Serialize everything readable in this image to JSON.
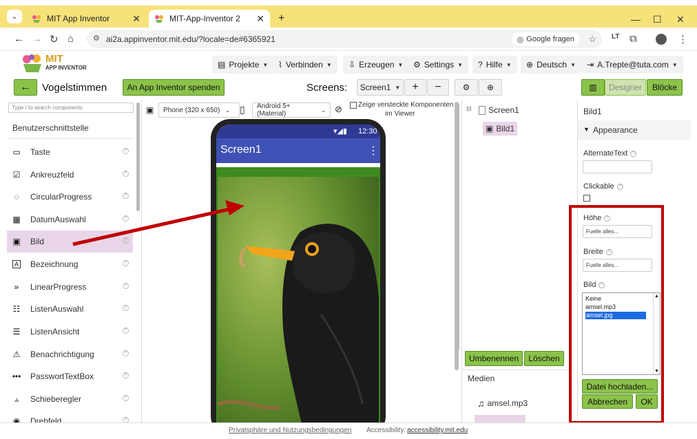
{
  "browser": {
    "tabs": [
      {
        "label": "MIT App Inventor"
      },
      {
        "label": "MIT-App-Inventor 2"
      }
    ],
    "url": "ai2a.appinventor.mit.edu/?locale=de#6365921",
    "google_ask": "Google fragen"
  },
  "header": {
    "logo_top": "MIT",
    "logo_bottom": "APP INVENTOR",
    "menu": [
      {
        "label": "Projekte"
      },
      {
        "label": "Verbinden"
      },
      {
        "label": "Erzeugen"
      },
      {
        "label": "Settings"
      },
      {
        "label": "Hilfe"
      },
      {
        "label": "Deutsch"
      },
      {
        "label": "A.Trepte@tuta.com"
      }
    ]
  },
  "toolbar": {
    "project_name": "Vogelstimmen",
    "donate": "An App Inventor spenden",
    "screens_label": "Screens:",
    "screen_select": "Screen1",
    "designer": "Designer",
    "blocks": "Blöcke"
  },
  "palette": {
    "search_placeholder": "Type / to search components",
    "category": "Benutzerschnittstelle",
    "items": [
      {
        "label": "Taste",
        "icon": "button-icon"
      },
      {
        "label": "Ankreuzfeld",
        "icon": "checkbox-icon"
      },
      {
        "label": "CircularProgress",
        "icon": "circular-progress-icon"
      },
      {
        "label": "DatumAuswahl",
        "icon": "date-picker-icon"
      },
      {
        "label": "Bild",
        "icon": "image-icon"
      },
      {
        "label": "Bezeichnung",
        "icon": "label-icon"
      },
      {
        "label": "LinearProgress",
        "icon": "linear-progress-icon"
      },
      {
        "label": "ListenAuswahl",
        "icon": "list-picker-icon"
      },
      {
        "label": "ListenAnsicht",
        "icon": "list-view-icon"
      },
      {
        "label": "Benachrichtigung",
        "icon": "notifier-icon"
      },
      {
        "label": "PasswortTextBox",
        "icon": "password-icon"
      },
      {
        "label": "Schieberegler",
        "icon": "slider-icon"
      },
      {
        "label": "Drehfeld",
        "icon": "spinner-icon"
      }
    ]
  },
  "viewer": {
    "size_select": "Phone (320 x 650)",
    "os_select": "Android 5+ (Material)",
    "hidden_label_1": "Zeige versteckte Komponenten",
    "hidden_label_2": "im Viewer",
    "status_time": "12:30",
    "app_title": "Screen1"
  },
  "tree": {
    "root": "Screen1",
    "child": "Bild1",
    "rename": "Umbenennen",
    "delete": "Löschen",
    "media_title": "Medien",
    "media": [
      {
        "label": "amsel.mp3"
      }
    ]
  },
  "properties": {
    "component": "Bild1",
    "section": "Appearance",
    "alternate_text": "AlternateText",
    "clickable": "Clickable",
    "height_label": "Höhe",
    "height_value": "Fuelle alles...",
    "width_label": "Breite",
    "width_value": "Fuelle alles...",
    "picture_label": "Bild",
    "picture_options": [
      "Keine",
      "amsel.mp3",
      "amsel.jpg"
    ],
    "upload": "Datei hochladen...",
    "cancel": "Abbrechen",
    "ok": "OK"
  },
  "footer": {
    "privacy": "Privatsphäre und Nutzungsbedingungen",
    "accessibility_label": "Accessibility:",
    "accessibility_link": "accessibility.mit.edu"
  },
  "colors": {
    "accent_green": "#8bc34a",
    "app_bar": "#3f51b5",
    "annotation_red": "#c00000",
    "tab_bar": "#f7e27a"
  }
}
